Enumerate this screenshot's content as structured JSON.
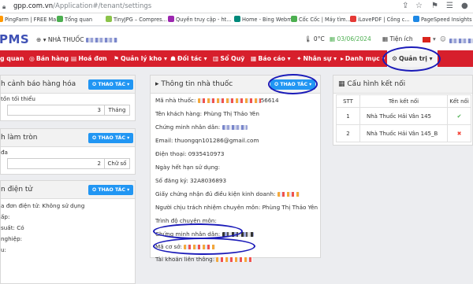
{
  "browser": {
    "url_host": "gpp.com.vn",
    "url_path": "/Application#/tenant/settings",
    "bookmarks": [
      {
        "label": "PingFarm | FREE Ma...",
        "color": "#ff9800"
      },
      {
        "label": "Tổng quan",
        "color": "#4caf50"
      },
      {
        "label": "TinyJPG – Compres...",
        "color": "#8bc34a"
      },
      {
        "label": "Quyền truy cập - ht...",
        "color": "#9c27b0"
      },
      {
        "label": "Home - Bing Webm...",
        "color": "#00897b"
      },
      {
        "label": "Cốc Cốc | Máy tìm...",
        "color": "#4caf50"
      },
      {
        "label": "iLovePDF | Công c...",
        "color": "#e53935"
      },
      {
        "label": "PageSpeed Insights",
        "color": "#1e88e5"
      }
    ]
  },
  "header": {
    "logo": "PMS",
    "shop_label": "NHÀ THUỐC",
    "temperature": "0°C",
    "date": "03/06/2024",
    "utility": "Tiện ích"
  },
  "nav": [
    {
      "label": "g quan",
      "glyph": ""
    },
    {
      "label": "Bán hàng",
      "glyph": "◎"
    },
    {
      "label": "Hoá đơn",
      "glyph": "▤"
    },
    {
      "label": "Quản lý kho",
      "glyph": "⚑",
      "caret": "▾"
    },
    {
      "label": "Đối tác",
      "glyph": "☗",
      "caret": "▾"
    },
    {
      "label": "Sổ Quỹ",
      "glyph": "▥"
    },
    {
      "label": "Báo cáo",
      "glyph": "▦",
      "caret": "▾"
    },
    {
      "label": "Nhân sự",
      "glyph": "✦",
      "caret": "▾"
    },
    {
      "label": "Danh mục",
      "glyph": "▸",
      "caret": "▾"
    },
    {
      "label": "Quản trị",
      "glyph": "⚙",
      "caret": "▾",
      "active": true
    }
  ],
  "action_label": "THAO TÁC",
  "left_panels": {
    "stock_warning": {
      "title": "h cảnh báo hàng hóa",
      "subtitle": "tồn tối thiểu",
      "value": "3",
      "unit": "Tháng"
    },
    "rounding": {
      "title": "h làm tròn",
      "subtitle": "đa",
      "value": "2",
      "unit": "Chữ số"
    },
    "einvoice": {
      "title": "n điện tử",
      "lines": [
        "a đơn điện tử: Không sử dụng",
        "ấp:",
        "suất: Có",
        "nghiệp:",
        "u:"
      ]
    }
  },
  "pharmacy": {
    "title": "Thông tin nhà thuốc",
    "fields": [
      {
        "label": "Mã nhà thuốc:",
        "value": "56614",
        "blur": true
      },
      {
        "label": "Tên khách hàng:",
        "value": "Phùng Thị Thảo Yên"
      },
      {
        "label": "Chứng minh nhân dân:",
        "value": "",
        "blur": true
      },
      {
        "label": "Email:",
        "value": "thuongqn101286@gmail.com"
      },
      {
        "label": "Điện thoại:",
        "value": "0935410973"
      },
      {
        "label": "Ngày hết hạn sử dụng:",
        "value": ""
      },
      {
        "label": "Số đăng ký:",
        "value": "32A8036893"
      },
      {
        "label": "Giấy chứng nhận đủ điều kiện kinh doanh:",
        "value": "",
        "blur": true
      },
      {
        "label": "Người chịu trách nhiệm chuyên môn:",
        "value": "Phùng Thị Thảo Yên"
      },
      {
        "label": "Trình độ chuyên môn:",
        "value": ""
      },
      {
        "label": "Chứng minh nhân dân:",
        "value": "",
        "blur": true
      },
      {
        "label": "Mã cơ sở:",
        "value": "",
        "blur": true
      },
      {
        "label": "Tài khoản liên thông:",
        "value": "",
        "blur": true
      }
    ]
  },
  "connections": {
    "title": "Cấu hình kết nối",
    "headers": [
      "STT",
      "Tên kết nối",
      "Kết nối"
    ],
    "rows": [
      {
        "stt": "1",
        "name": "Nhà Thuốc Hải Vân 145",
        "status": "✔",
        "color": "#4caf50"
      },
      {
        "stt": "2",
        "name": "Nhà Thuốc Hải Vân 145_B",
        "status": "✖",
        "color": "#f44336"
      }
    ]
  }
}
